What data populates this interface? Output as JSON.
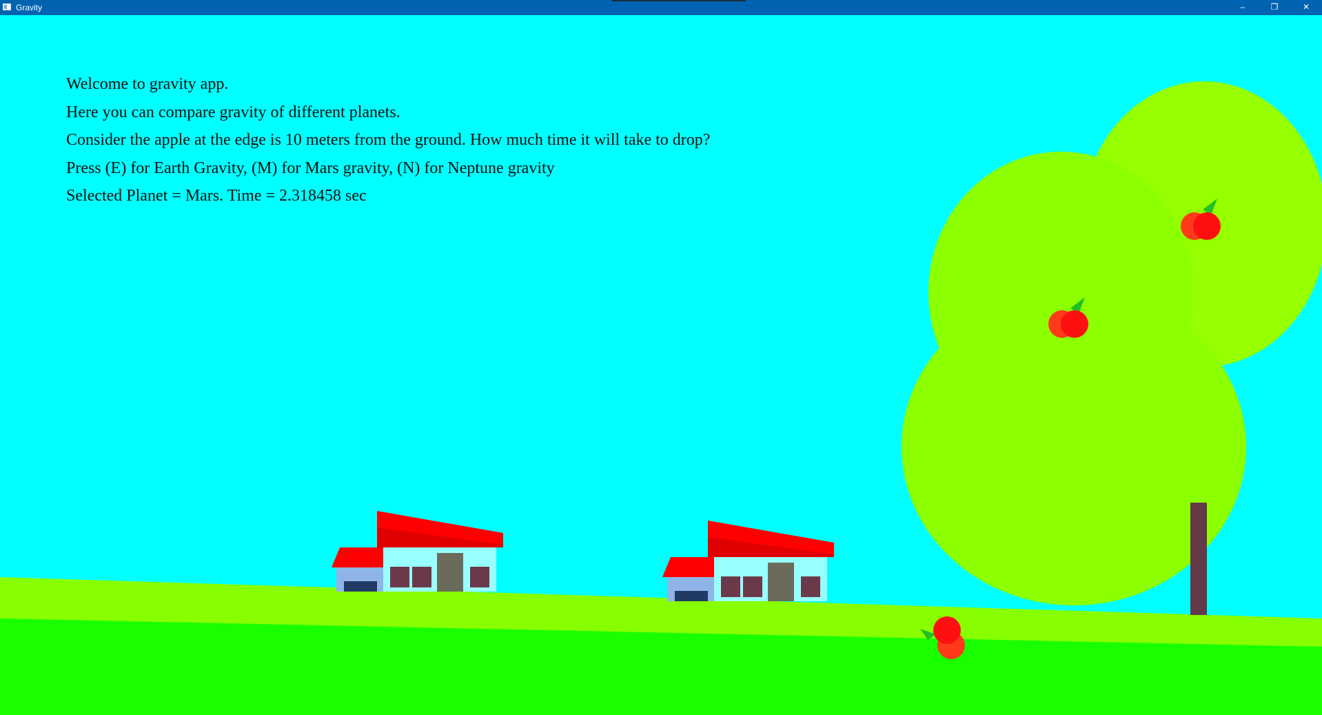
{
  "window": {
    "title": "Gravity",
    "controls": {
      "minimize": "–",
      "maximize": "❐",
      "close": "✕"
    }
  },
  "info": {
    "line1": "Welcome to gravity app.",
    "line2": "Here you can compare gravity of different planets.",
    "line3": "Consider the apple at the edge is 10 meters from the ground. How much time it will take to drop?",
    "line4": "Press (E) for Earth Gravity, (M) for Mars gravity, (N) for Neptune gravity",
    "line5": "Selected Planet = Mars. Time = 2.318458 sec"
  },
  "colors": {
    "sky": "#00ffff",
    "titlebar": "#0063b1",
    "ground_far": "#88ff00",
    "ground_near": "#1aff00",
    "foliage": "#8cff00",
    "trunk": "#633a48",
    "apple": "#ff1a1a",
    "roof": "#ff0000",
    "house_wall": "#99ffff"
  },
  "icons": {
    "app": "window-icon"
  }
}
